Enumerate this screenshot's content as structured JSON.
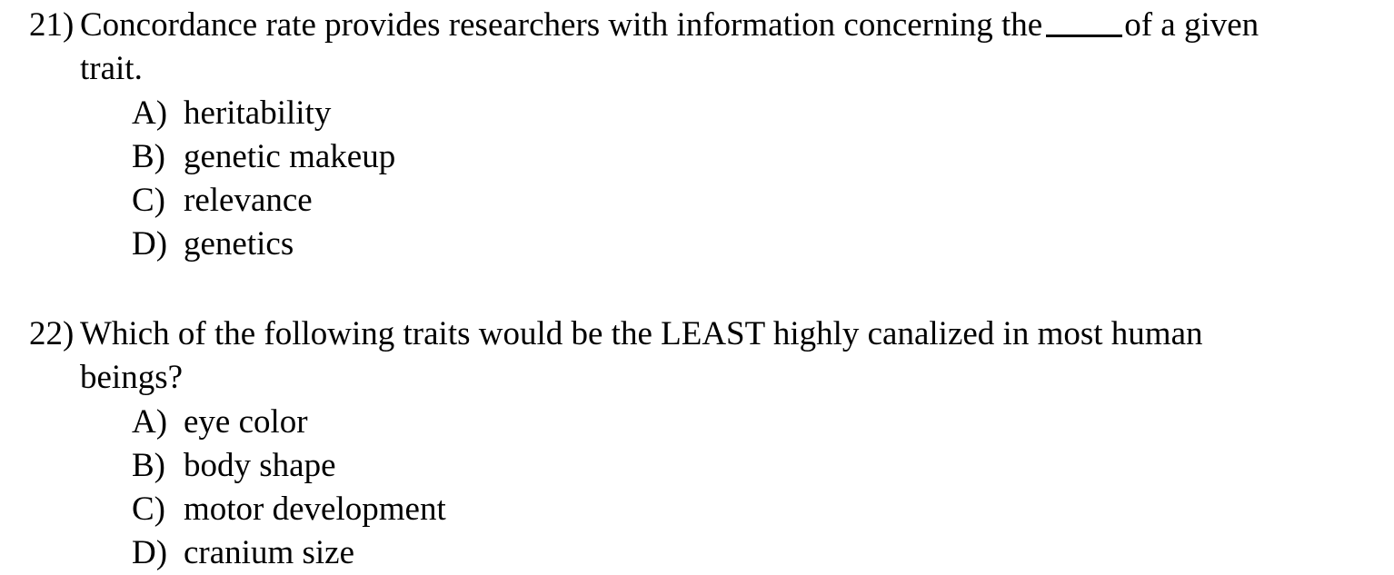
{
  "document": {
    "type": "multiple-choice-quiz",
    "background_color": "#ffffff",
    "text_color": "#000000",
    "questions": [
      {
        "number": "21)",
        "stem_line1": "Concordance rate provides researchers with information concerning the",
        "blank": "_____",
        "stem_line1_after_blank": "of a given",
        "stem_line2": "trait.",
        "options": [
          {
            "letter": "A)",
            "text": "heritability"
          },
          {
            "letter": "B)",
            "text": "genetic makeup"
          },
          {
            "letter": "C)",
            "text": "relevance"
          },
          {
            "letter": "D)",
            "text": "genetics"
          }
        ]
      },
      {
        "number": "22)",
        "stem_line1": "Which of the following traits would be the LEAST highly canalized in most human beings?",
        "options": [
          {
            "letter": "A)",
            "text": "eye color"
          },
          {
            "letter": "B)",
            "text": "body shape"
          },
          {
            "letter": "C)",
            "text": "motor development"
          },
          {
            "letter": "D)",
            "text": "cranium size"
          }
        ]
      }
    ]
  }
}
